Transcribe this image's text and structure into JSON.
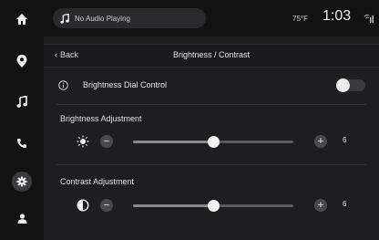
{
  "sidebar": {
    "items": [
      {
        "icon": "home-icon"
      },
      {
        "icon": "map-pin-icon"
      },
      {
        "icon": "music-note-icon"
      },
      {
        "icon": "phone-icon"
      },
      {
        "icon": "gear-icon",
        "active": true
      },
      {
        "icon": "person-icon"
      }
    ]
  },
  "topbar": {
    "now_playing": "No Audio Playing",
    "temperature": "75°F",
    "time": "1:03"
  },
  "header": {
    "back_label": "Back",
    "title": "Brightness / Contrast"
  },
  "dial_control": {
    "label": "Brightness Dial Control",
    "enabled": false
  },
  "brightness": {
    "label": "Brightness Adjustment",
    "minus": "−",
    "plus": "+",
    "value": "6",
    "level": 0.5
  },
  "contrast": {
    "label": "Contrast Adjustment",
    "minus": "−",
    "plus": "+",
    "value": "6",
    "level": 0.5
  },
  "colors": {
    "background": "#1e1e20",
    "sidebar": "#121213",
    "accent": "#f2f2f2"
  }
}
